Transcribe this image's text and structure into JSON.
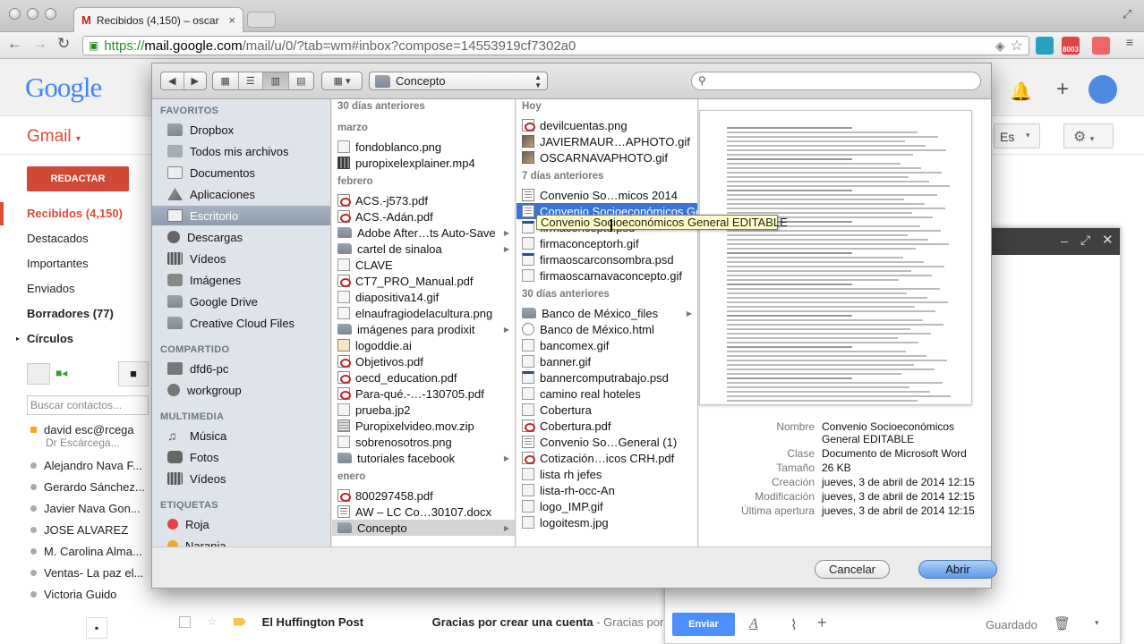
{
  "browser": {
    "tab_title": "Recibidos (4,150) – oscar",
    "url_scheme": "https://",
    "url_host": "mail.google.com",
    "url_path": "/mail/u/0/?tab=wm#inbox?compose=14553919cf7302a0",
    "ext_badge": "8003"
  },
  "gmail": {
    "logo": "Google",
    "app_label": "Gmail",
    "compose_button": "REDACTAR",
    "nav": [
      {
        "label": "Recibidos (4,150)",
        "active": true
      },
      {
        "label": "Destacados"
      },
      {
        "label": "Importantes"
      },
      {
        "label": "Enviados"
      },
      {
        "label": "Borradores (77)",
        "bold": true
      },
      {
        "label": "Círculos",
        "bold": true
      }
    ],
    "search_contacts_placeholder": "Buscar contactos...",
    "contacts": [
      "david esc@rcega",
      "Dr Escárcega...",
      "Alejandro Nava F...",
      "Gerardo Sánchez...",
      "Javier Nava Gon...",
      "JOSE ALVAREZ",
      "M. Carolina Alma...",
      "Ventas- La paz el...",
      "Victoria Guido"
    ],
    "language_btn": "Es",
    "mail_rows": [
      {
        "sender": "El Huffington Post",
        "subject": "Gracias por crear una cuenta",
        "snippet": " - Gracias por"
      }
    ],
    "compose_send": "Enviar",
    "compose_saved": "Guardado"
  },
  "dialog": {
    "path_popup": "Concepto",
    "search_value": "",
    "sidebar": {
      "sections": [
        {
          "title": "FAVORITOS",
          "items": [
            "Dropbox",
            "Todos mis archivos",
            "Documentos",
            "Aplicaciones",
            "Escritorio",
            "Descargas",
            "Vídeos",
            "Imágenes",
            "Google Drive",
            "Creative Cloud Files"
          ],
          "selected": "Escritorio"
        },
        {
          "title": "COMPARTIDO",
          "items": [
            "dfd6-pc",
            "workgroup"
          ]
        },
        {
          "title": "MULTIMEDIA",
          "items": [
            "Música",
            "Fotos",
            "Vídeos"
          ]
        },
        {
          "title": "ETIQUETAS",
          "items": [
            "Roja",
            "Naranja"
          ]
        }
      ]
    },
    "col1": {
      "groups": [
        {
          "title": "30 días anteriores",
          "items": []
        },
        {
          "title": "marzo",
          "items": [
            {
              "name": "fondoblanco.png",
              "type": "gen"
            },
            {
              "name": "puropixelexplainer.mp4",
              "type": "vid"
            }
          ]
        },
        {
          "title": "febrero",
          "items": [
            {
              "name": "ACS.-j573.pdf",
              "type": "pdf"
            },
            {
              "name": "ACS.-Adán.pdf",
              "type": "pdf"
            },
            {
              "name": "Adobe After…ts Auto-Save",
              "type": "folder",
              "arrow": true
            },
            {
              "name": "cartel de sinaloa",
              "type": "folder",
              "arrow": true
            },
            {
              "name": "CLAVE",
              "type": "gen"
            },
            {
              "name": "CT7_PRO_Manual.pdf",
              "type": "pdf"
            },
            {
              "name": "diapositiva14.gif",
              "type": "gen"
            },
            {
              "name": "elnaufragiodelacultura.png",
              "type": "gen"
            },
            {
              "name": "imágenes para prodixit",
              "type": "folder",
              "arrow": true
            },
            {
              "name": "logoddie.ai",
              "type": "ai"
            },
            {
              "name": "Objetivos.pdf",
              "type": "pdf"
            },
            {
              "name": "oecd_education.pdf",
              "type": "pdf"
            },
            {
              "name": "Para-qué.-…-130705.pdf",
              "type": "pdf"
            },
            {
              "name": "prueba.jp2",
              "type": "gen"
            },
            {
              "name": "Puropixelvideo.mov.zip",
              "type": "zip"
            },
            {
              "name": "sobrenosotros.png",
              "type": "gen"
            },
            {
              "name": "tutoriales facebook",
              "type": "folder",
              "arrow": true
            }
          ]
        },
        {
          "title": "enero",
          "items": [
            {
              "name": "800297458.pdf",
              "type": "pdf"
            },
            {
              "name": "AW – LC Co…30107.docx",
              "type": "doc"
            },
            {
              "name": "Concepto",
              "type": "folder",
              "arrow": true,
              "selected": true
            }
          ]
        }
      ]
    },
    "col2": {
      "groups": [
        {
          "title": "Hoy",
          "items": [
            {
              "name": "devilcuentas.png",
              "type": "pdf"
            },
            {
              "name": "JAVIERMAUR…APHOTO.gif",
              "type": "img"
            },
            {
              "name": "OSCARNAVAPHOTO.gif",
              "type": "img"
            }
          ]
        },
        {
          "title": "7 días anteriores",
          "items": [
            {
              "name": "Convenio So…micos 2014",
              "type": "doc"
            },
            {
              "name": "Convenio Socioeconómicos General EDITABLE",
              "type": "doc",
              "highlight": true
            },
            {
              "name": "firmaconcepto.psd",
              "type": "psd"
            },
            {
              "name": "firmaconceptorh.gif",
              "type": "gen"
            },
            {
              "name": "firmaoscarconsombra.psd",
              "type": "psd"
            },
            {
              "name": "firmaoscarnavaconcepto.gif",
              "type": "gen"
            }
          ]
        },
        {
          "title": "30 días anteriores",
          "items": [
            {
              "name": "Banco de México_files",
              "type": "folder",
              "arrow": true
            },
            {
              "name": "Banco de México.html",
              "type": "html"
            },
            {
              "name": "bancomex.gif",
              "type": "gen"
            },
            {
              "name": "banner.gif",
              "type": "gen"
            },
            {
              "name": "bannercomputrabajo.psd",
              "type": "psd"
            },
            {
              "name": "camino real hoteles",
              "type": "gen"
            },
            {
              "name": "Cobertura",
              "type": "gen"
            },
            {
              "name": "Cobertura.pdf",
              "type": "pdf"
            },
            {
              "name": "Convenio So…General (1)",
              "type": "doc"
            },
            {
              "name": "Cotización…icos CRH.pdf",
              "type": "pdf"
            },
            {
              "name": "lista rh jefes",
              "type": "gen"
            },
            {
              "name": "lista-rh-occ-An",
              "type": "gen"
            },
            {
              "name": "logo_IMP.gif",
              "type": "gen"
            },
            {
              "name": "logoitesm.jpg",
              "type": "gen"
            }
          ]
        }
      ]
    },
    "tooltip": "Convenio Socioeconómicos General EDITABLE",
    "info": [
      {
        "k": "Nombre",
        "v": "Convenio Socioeconómicos",
        "v2": "General EDITABLE"
      },
      {
        "k": "Clase",
        "v": "Documento de Microsoft Word"
      },
      {
        "k": "Tamaño",
        "v": "26 KB"
      },
      {
        "k": "Creación",
        "v": "jueves, 3 de abril de 2014 12:15"
      },
      {
        "k": "Modificación",
        "v": "jueves, 3 de abril de 2014 12:15"
      },
      {
        "k": "Última apertura",
        "v": "jueves, 3 de abril de 2014 12:15"
      }
    ],
    "cancel_label": "Cancelar",
    "open_label": "Abrir"
  }
}
